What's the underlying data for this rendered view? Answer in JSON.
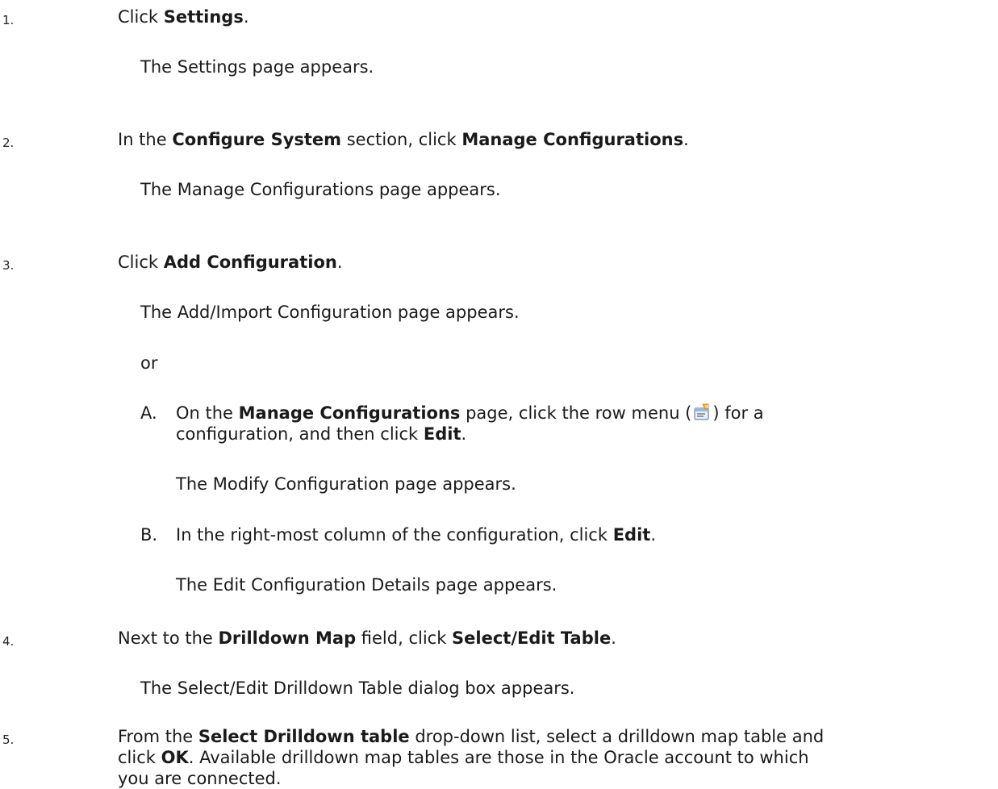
{
  "steps": [
    {
      "number": "1.",
      "pre": "Click ",
      "bold1": "Settings",
      "post": ".",
      "result": "The Settings page appears."
    },
    {
      "number": "2.",
      "pre": "In the ",
      "bold1": "Configure System",
      "mid": " section, click ",
      "bold2": "Manage Configurations",
      "post": ".",
      "result": "The Manage Configurations page appears."
    },
    {
      "number": "3.",
      "pre": "Click ",
      "bold1": "Add Configuration",
      "post": ".",
      "result": "The Add/Import Configuration page appears.",
      "or": "or"
    },
    {
      "number": "4.",
      "pre": "Next to the ",
      "bold1": "Drilldown Map",
      "mid": " field, click ",
      "bold2": "Select/Edit Table",
      "post": ".",
      "result": "The Select/Edit Drilldown Table dialog box appears."
    },
    {
      "number": "5.",
      "pre": "From the ",
      "bold1": "Select Drilldown table",
      "mid": " drop-down list, select a drilldown map table and",
      "line2_pre": "click ",
      "bold2": "OK",
      "line2_post": ". Available drilldown map tables are those in the Oracle account to which",
      "line3": "you are connected."
    }
  ],
  "substeps": [
    {
      "letter": "A.",
      "pre": "On the ",
      "bold1": "Manage Configurations",
      "mid": " page, click the row menu (",
      "after_icon": ") for a",
      "line2_pre": "configuration, and then click ",
      "bold2": "Edit",
      "line2_post": ".",
      "result": "The Modify Configuration page appears.",
      "icon": "row-menu-icon"
    },
    {
      "letter": "B.",
      "pre": "In the right-most column of the configuration, click ",
      "bold1": "Edit",
      "post": ".",
      "result": "The Edit Configuration Details page appears."
    }
  ]
}
